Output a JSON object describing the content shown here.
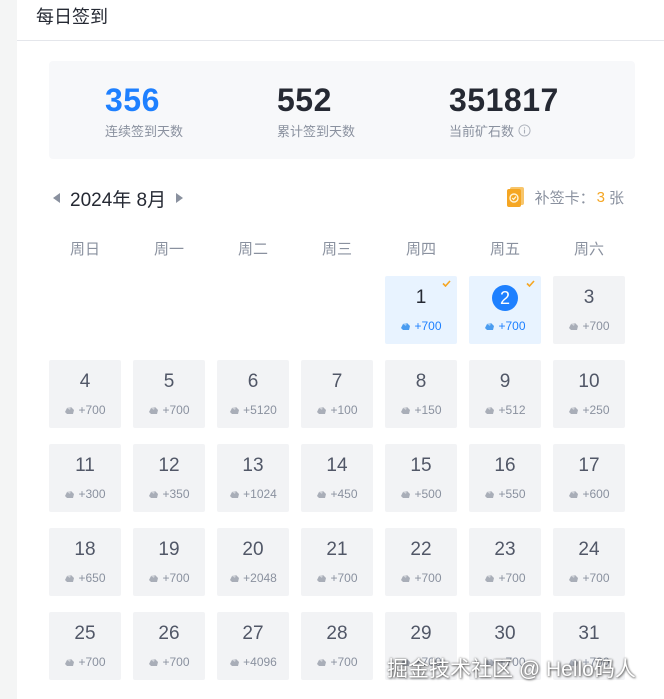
{
  "header": {
    "title": "每日签到"
  },
  "stats": [
    {
      "value": "356",
      "label": "连续签到天数",
      "primary": true,
      "info": false
    },
    {
      "value": "552",
      "label": "累计签到天数",
      "primary": false,
      "info": false
    },
    {
      "value": "351817",
      "label": "当前矿石数",
      "primary": false,
      "info": true
    }
  ],
  "calendar": {
    "month_label": "2024年 8月",
    "makeup": {
      "label": "补签卡：",
      "count": "3",
      "unit": "张"
    },
    "weekdays": [
      "周日",
      "周一",
      "周二",
      "周三",
      "周四",
      "周五",
      "周六"
    ],
    "first_weekday_index": 4,
    "days": [
      {
        "day": "1",
        "reward": "+700",
        "signed": true,
        "today": false
      },
      {
        "day": "2",
        "reward": "+700",
        "signed": true,
        "today": true
      },
      {
        "day": "3",
        "reward": "+700",
        "signed": false,
        "today": false
      },
      {
        "day": "4",
        "reward": "+700",
        "signed": false,
        "today": false
      },
      {
        "day": "5",
        "reward": "+700",
        "signed": false,
        "today": false
      },
      {
        "day": "6",
        "reward": "+5120",
        "signed": false,
        "today": false
      },
      {
        "day": "7",
        "reward": "+100",
        "signed": false,
        "today": false
      },
      {
        "day": "8",
        "reward": "+150",
        "signed": false,
        "today": false
      },
      {
        "day": "9",
        "reward": "+512",
        "signed": false,
        "today": false
      },
      {
        "day": "10",
        "reward": "+250",
        "signed": false,
        "today": false
      },
      {
        "day": "11",
        "reward": "+300",
        "signed": false,
        "today": false
      },
      {
        "day": "12",
        "reward": "+350",
        "signed": false,
        "today": false
      },
      {
        "day": "13",
        "reward": "+1024",
        "signed": false,
        "today": false
      },
      {
        "day": "14",
        "reward": "+450",
        "signed": false,
        "today": false
      },
      {
        "day": "15",
        "reward": "+500",
        "signed": false,
        "today": false
      },
      {
        "day": "16",
        "reward": "+550",
        "signed": false,
        "today": false
      },
      {
        "day": "17",
        "reward": "+600",
        "signed": false,
        "today": false
      },
      {
        "day": "18",
        "reward": "+650",
        "signed": false,
        "today": false
      },
      {
        "day": "19",
        "reward": "+700",
        "signed": false,
        "today": false
      },
      {
        "day": "20",
        "reward": "+2048",
        "signed": false,
        "today": false
      },
      {
        "day": "21",
        "reward": "+700",
        "signed": false,
        "today": false
      },
      {
        "day": "22",
        "reward": "+700",
        "signed": false,
        "today": false
      },
      {
        "day": "23",
        "reward": "+700",
        "signed": false,
        "today": false
      },
      {
        "day": "24",
        "reward": "+700",
        "signed": false,
        "today": false
      },
      {
        "day": "25",
        "reward": "+700",
        "signed": false,
        "today": false
      },
      {
        "day": "26",
        "reward": "+700",
        "signed": false,
        "today": false
      },
      {
        "day": "27",
        "reward": "+4096",
        "signed": false,
        "today": false
      },
      {
        "day": "28",
        "reward": "+700",
        "signed": false,
        "today": false
      },
      {
        "day": "29",
        "reward": "+700",
        "signed": false,
        "today": false
      },
      {
        "day": "30",
        "reward": "+700",
        "signed": false,
        "today": false
      },
      {
        "day": "31",
        "reward": "+700",
        "signed": false,
        "today": false
      }
    ]
  },
  "watermark": "掘金技术社区 @ Hello码人",
  "colors": {
    "primary": "#1e80ff",
    "accent": "#f5a623",
    "cell_bg": "#f2f3f5",
    "signed_bg": "#e8f3ff"
  },
  "icons": {
    "info": "info-circle-icon",
    "makeup_card": "card-icon",
    "ore": "ore-icon",
    "check": "check-icon"
  }
}
